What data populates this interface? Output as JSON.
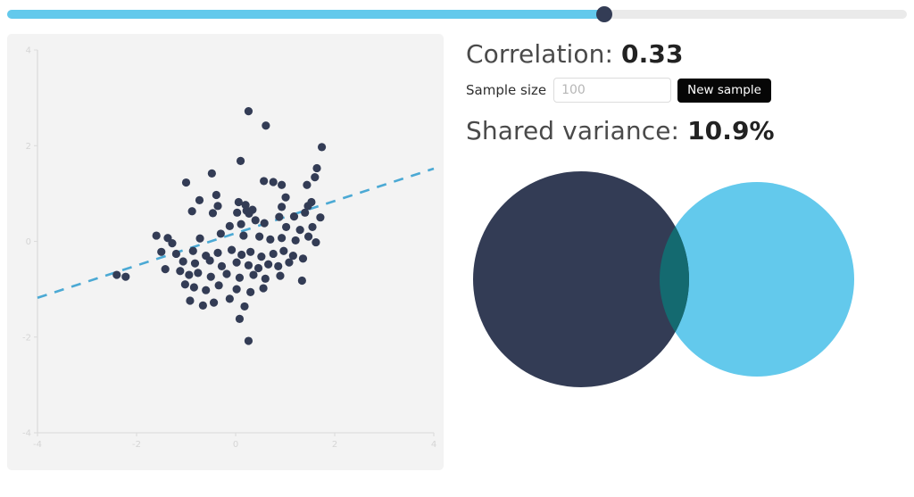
{
  "slider": {
    "name": "correlation-slider",
    "value_fraction": 0.664,
    "fill_color": "#63c9ec",
    "track_color": "#eaeaea",
    "thumb_color": "#333c55"
  },
  "stats": {
    "correlation_label": "Correlation:",
    "correlation_value": "0.33",
    "shared_variance_label": "Shared variance:",
    "shared_variance_value": "10.9%"
  },
  "controls": {
    "sample_size_label": "Sample size",
    "sample_size_value": "",
    "sample_size_placeholder": "100",
    "new_sample_label": "New sample"
  },
  "venn": {
    "left_circle_color": "#333c55",
    "right_circle_color": "#63c9ec",
    "overlap_color": "#146a70"
  },
  "chart_data": {
    "type": "scatter",
    "title": "",
    "xlabel": "",
    "ylabel": "",
    "xlim": [
      -4,
      4
    ],
    "ylim": [
      -4,
      4
    ],
    "xticks": [
      -4,
      -2,
      0,
      2,
      4
    ],
    "yticks": [
      -4,
      -2,
      0,
      2,
      4
    ],
    "xtick_labels": [
      "-4",
      "-2",
      "0",
      "2",
      "4"
    ],
    "ytick_labels": [
      "-4",
      "-2",
      "0",
      "2",
      "4"
    ],
    "grid": false,
    "legend": "none",
    "point_color": "#333c55",
    "point_radius": 4.6,
    "n": 100,
    "correlation": 0.33,
    "shared_variance_pct": 10.9,
    "trendline": {
      "style": "dashed",
      "color": "#4ba9d4",
      "x": [
        -4.0,
        4.0
      ],
      "y": [
        -1.18,
        1.52
      ]
    },
    "points": [
      [
        0.26,
        2.72
      ],
      [
        0.61,
        2.42
      ],
      [
        1.74,
        1.97
      ],
      [
        1.64,
        1.53
      ],
      [
        0.1,
        1.68
      ],
      [
        1.6,
        1.34
      ],
      [
        -0.48,
        1.42
      ],
      [
        -1.0,
        1.23
      ],
      [
        0.57,
        1.26
      ],
      [
        1.44,
        1.18
      ],
      [
        0.93,
        1.18
      ],
      [
        0.76,
        1.24
      ],
      [
        -0.39,
        0.97
      ],
      [
        -0.73,
        0.86
      ],
      [
        1.01,
        0.92
      ],
      [
        -0.36,
        0.74
      ],
      [
        0.2,
        0.76
      ],
      [
        0.06,
        0.82
      ],
      [
        0.93,
        0.72
      ],
      [
        1.4,
        0.6
      ],
      [
        1.53,
        0.82
      ],
      [
        1.46,
        0.74
      ],
      [
        -0.88,
        0.63
      ],
      [
        -0.46,
        0.59
      ],
      [
        0.03,
        0.6
      ],
      [
        0.22,
        0.64
      ],
      [
        0.34,
        0.66
      ],
      [
        0.27,
        0.58
      ],
      [
        0.88,
        0.51
      ],
      [
        1.18,
        0.52
      ],
      [
        1.71,
        0.5
      ],
      [
        0.4,
        0.44
      ],
      [
        0.11,
        0.36
      ],
      [
        0.58,
        0.38
      ],
      [
        -0.12,
        0.32
      ],
      [
        1.02,
        0.3
      ],
      [
        1.3,
        0.24
      ],
      [
        1.55,
        0.3
      ],
      [
        -1.6,
        0.12
      ],
      [
        -1.37,
        0.07
      ],
      [
        -1.28,
        -0.04
      ],
      [
        -0.72,
        0.06
      ],
      [
        -0.3,
        0.16
      ],
      [
        0.16,
        0.12
      ],
      [
        0.48,
        0.1
      ],
      [
        0.7,
        0.04
      ],
      [
        0.93,
        0.07
      ],
      [
        1.21,
        0.02
      ],
      [
        1.47,
        0.1
      ],
      [
        1.62,
        -0.02
      ],
      [
        -1.5,
        -0.22
      ],
      [
        -1.2,
        -0.26
      ],
      [
        -0.86,
        -0.2
      ],
      [
        -0.6,
        -0.3
      ],
      [
        -0.36,
        -0.24
      ],
      [
        -0.08,
        -0.18
      ],
      [
        0.12,
        -0.28
      ],
      [
        0.3,
        -0.22
      ],
      [
        0.52,
        -0.32
      ],
      [
        0.76,
        -0.26
      ],
      [
        0.97,
        -0.2
      ],
      [
        1.16,
        -0.3
      ],
      [
        1.36,
        -0.36
      ],
      [
        -1.06,
        -0.42
      ],
      [
        -0.82,
        -0.46
      ],
      [
        -0.52,
        -0.4
      ],
      [
        -0.28,
        -0.52
      ],
      [
        0.02,
        -0.44
      ],
      [
        0.26,
        -0.5
      ],
      [
        0.46,
        -0.56
      ],
      [
        0.66,
        -0.48
      ],
      [
        0.86,
        -0.52
      ],
      [
        1.08,
        -0.44
      ],
      [
        -1.42,
        -0.58
      ],
      [
        -1.12,
        -0.62
      ],
      [
        -0.94,
        -0.7
      ],
      [
        -0.76,
        -0.66
      ],
      [
        -0.5,
        -0.74
      ],
      [
        -0.18,
        -0.68
      ],
      [
        0.08,
        -0.76
      ],
      [
        0.36,
        -0.7
      ],
      [
        0.6,
        -0.78
      ],
      [
        0.9,
        -0.72
      ],
      [
        -2.4,
        -0.7
      ],
      [
        -2.22,
        -0.74
      ],
      [
        -1.02,
        -0.9
      ],
      [
        -0.84,
        -0.96
      ],
      [
        -0.6,
        -1.02
      ],
      [
        -0.34,
        -0.92
      ],
      [
        0.02,
        -1.0
      ],
      [
        0.3,
        -1.06
      ],
      [
        0.56,
        -0.98
      ],
      [
        1.34,
        -0.82
      ],
      [
        -0.92,
        -1.24
      ],
      [
        -0.66,
        -1.34
      ],
      [
        -0.44,
        -1.28
      ],
      [
        -0.12,
        -1.2
      ],
      [
        0.18,
        -1.36
      ],
      [
        0.08,
        -1.62
      ],
      [
        0.26,
        -2.08
      ]
    ]
  }
}
